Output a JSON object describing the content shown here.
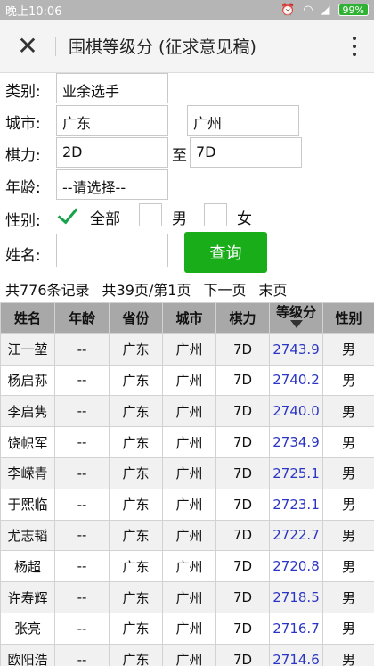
{
  "status": {
    "time": "晚上10:06",
    "battery": "99%"
  },
  "appbar": {
    "title": "围棋等级分 (征求意见稿)"
  },
  "form": {
    "category": {
      "label": "类别:",
      "value": "业余选手"
    },
    "city": {
      "label": "城市:",
      "province": "广东",
      "city": "广州"
    },
    "strength": {
      "label": "棋力:",
      "from": "2D",
      "to_label": "至",
      "to": "7D"
    },
    "age": {
      "label": "年龄:",
      "value": "--请选择--"
    },
    "gender": {
      "label": "性别:",
      "options": [
        "全部",
        "男",
        "女"
      ],
      "selected": "全部"
    },
    "name": {
      "label": "姓名:",
      "value": ""
    },
    "query_label": "查询"
  },
  "pager": {
    "records": "共776条记录",
    "pages": "共39页/第1页",
    "next": "下一页",
    "last": "末页"
  },
  "table": {
    "headers": [
      "姓名",
      "年龄",
      "省份",
      "城市",
      "棋力",
      "等级分",
      "性别"
    ],
    "rows": [
      [
        "江一堃",
        "--",
        "广东",
        "广州",
        "7D",
        "2743.9",
        "男"
      ],
      [
        "杨启荪",
        "--",
        "广东",
        "广州",
        "7D",
        "2740.2",
        "男"
      ],
      [
        "李启隽",
        "--",
        "广东",
        "广州",
        "7D",
        "2740.0",
        "男"
      ],
      [
        "饶帜军",
        "--",
        "广东",
        "广州",
        "7D",
        "2734.9",
        "男"
      ],
      [
        "李嵘青",
        "--",
        "广东",
        "广州",
        "7D",
        "2725.1",
        "男"
      ],
      [
        "于熙临",
        "--",
        "广东",
        "广州",
        "7D",
        "2723.1",
        "男"
      ],
      [
        "尤志韬",
        "--",
        "广东",
        "广州",
        "7D",
        "2722.7",
        "男"
      ],
      [
        "杨超",
        "--",
        "广东",
        "广州",
        "7D",
        "2720.8",
        "男"
      ],
      [
        "许寿辉",
        "--",
        "广东",
        "广州",
        "7D",
        "2718.5",
        "男"
      ],
      [
        "张亮",
        "--",
        "广东",
        "广州",
        "7D",
        "2716.7",
        "男"
      ],
      [
        "欧阳浩",
        "--",
        "广东",
        "广州",
        "7D",
        "2714.6",
        "男"
      ]
    ]
  },
  "colors": {
    "accent": "#19ad19",
    "score": "#2b35c4",
    "header_bg": "#a8a8a8"
  }
}
